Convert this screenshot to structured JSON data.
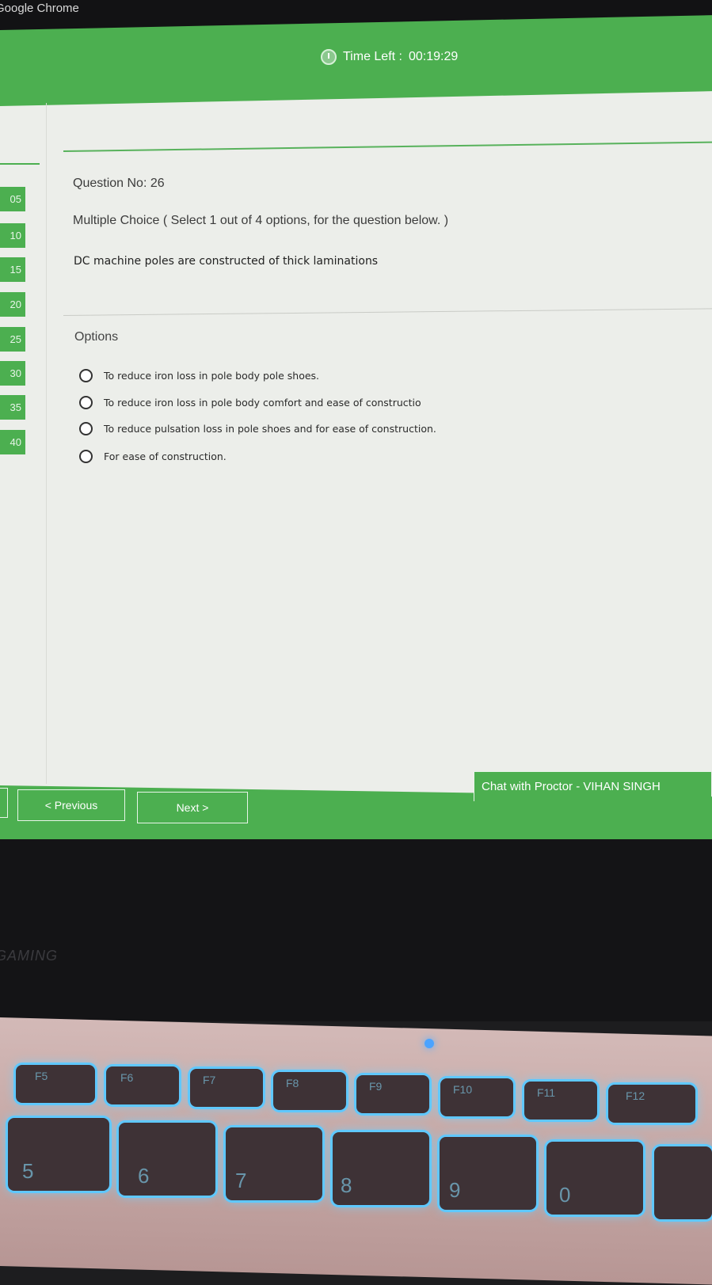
{
  "app": {
    "title": "Google Chrome"
  },
  "header": {
    "timer_label": "Time Left :",
    "timer_value": "00:19:29"
  },
  "sidebar": {
    "question_numbers": [
      "05",
      "10",
      "15",
      "20",
      "25",
      "30",
      "35",
      "40"
    ]
  },
  "question": {
    "number_text": "Question No: 26",
    "type_text": "Multiple Choice ( Select 1 out of 4 options, for the question below. )",
    "text": "DC machine poles are constructed of thick laminations",
    "options_heading": "Options",
    "options": [
      "To reduce iron loss in pole body pole shoes.",
      "To reduce iron loss in pole body comfort and ease of constructio",
      "To reduce pulsation loss in pole shoes and for ease  of construction.",
      "For ease of construction."
    ],
    "selected": null
  },
  "footer": {
    "previous_label": "< Previous",
    "next_label": "Next >",
    "chat_label": "Chat with Proctor - VIHAN SINGH"
  },
  "laptop": {
    "brand_text": "GAMING",
    "function_keys": [
      "F5",
      "F6",
      "F7",
      "F8",
      "F9",
      "F10",
      "F11",
      "F12"
    ],
    "number_keys": [
      "5",
      "6",
      "7",
      "8",
      "9",
      "0"
    ]
  },
  "colors": {
    "accent_green": "#4caf50",
    "page_background": "#eceeea",
    "keyboard_backlight": "#5fc8ff"
  }
}
